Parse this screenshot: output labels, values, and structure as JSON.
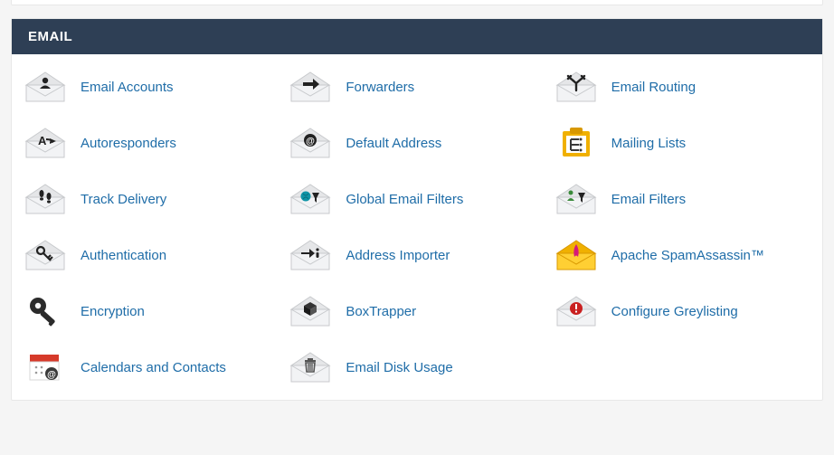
{
  "section": {
    "title": "EMAIL"
  },
  "items": [
    {
      "label": "Email Accounts",
      "icon": "person"
    },
    {
      "label": "Forwarders",
      "icon": "arrow-right"
    },
    {
      "label": "Email Routing",
      "icon": "route-split"
    },
    {
      "label": "Autoresponders",
      "icon": "a-reply"
    },
    {
      "label": "Default Address",
      "icon": "at-sign"
    },
    {
      "label": "Mailing Lists",
      "icon": "list-tree",
      "variant": "yellow"
    },
    {
      "label": "Track Delivery",
      "icon": "footprints"
    },
    {
      "label": "Global Email Filters",
      "icon": "funnel-global"
    },
    {
      "label": "Email Filters",
      "icon": "funnel-person"
    },
    {
      "label": "Authentication",
      "icon": "key"
    },
    {
      "label": "Address Importer",
      "icon": "arrow-in"
    },
    {
      "label": "Apache SpamAssassin™",
      "icon": "spam-feather",
      "variant": "yellow"
    },
    {
      "label": "Encryption",
      "icon": "big-key"
    },
    {
      "label": "BoxTrapper",
      "icon": "cube"
    },
    {
      "label": "Configure Greylisting",
      "icon": "alert-circle"
    },
    {
      "label": "Calendars and Contacts",
      "icon": "calendar-at"
    },
    {
      "label": "Email Disk Usage",
      "icon": "trash"
    }
  ]
}
